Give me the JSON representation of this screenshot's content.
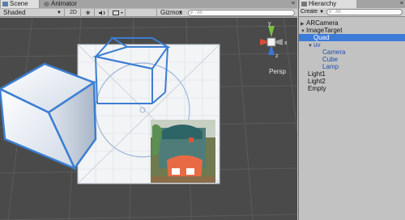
{
  "scene": {
    "tabs": [
      {
        "label": "Scene"
      },
      {
        "label": "Animator"
      }
    ],
    "toolbar": {
      "shading": "Shaded",
      "mode_2d": "2D",
      "gizmos": "Gizmos",
      "search_placeholder": "All"
    },
    "view_label": "Persp",
    "gizmo_axes": {
      "y": "y",
      "x": "x",
      "z": "z"
    }
  },
  "hierarchy": {
    "tab_label": "Hierarchy",
    "create_label": "Create",
    "search_placeholder": "All",
    "items": [
      {
        "label": "ARCamera",
        "expanded": false
      },
      {
        "label": "ImageTarget",
        "expanded": true
      },
      {
        "label": "Quad",
        "selected": true
      },
      {
        "label": "uv",
        "expanded": true
      },
      {
        "label": "Camera"
      },
      {
        "label": "Cube"
      },
      {
        "label": "Lamp"
      },
      {
        "label": "Light1"
      },
      {
        "label": "Light2"
      },
      {
        "label": "Empty"
      }
    ]
  },
  "colors": {
    "selection": "#3d7bd9",
    "child_text": "#1f4fb0",
    "cube_edge": "#3c7ed1",
    "gizmo_x": "#d94a3a",
    "gizmo_y": "#7ac043",
    "gizmo_z": "#3d74d6"
  }
}
